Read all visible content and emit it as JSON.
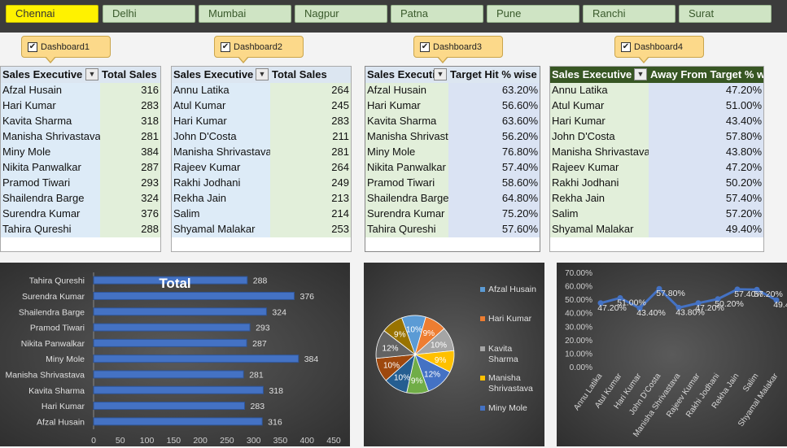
{
  "slicer": {
    "items": [
      "Chennai",
      "Delhi",
      "Mumbai",
      "Nagpur",
      "Patna",
      "Pune",
      "Ranchi",
      "Surat"
    ],
    "selected": "Chennai",
    "colors": {
      "selected": "#fff200",
      "normal": "#cfe4c4"
    }
  },
  "dashboards": [
    "Dashboard1",
    "Dashboard2",
    "Dashboard3",
    "Dashboard4"
  ],
  "tables": [
    {
      "col1": "Sales Executive",
      "col2": "Total Sales",
      "rows": [
        [
          "Afzal Husain",
          "316"
        ],
        [
          "Hari Kumar",
          "283"
        ],
        [
          "Kavita Sharma",
          "318"
        ],
        [
          "Manisha Shrivastava",
          "281"
        ],
        [
          "Miny Mole",
          "384"
        ],
        [
          "Nikita Panwalkar",
          "287"
        ],
        [
          "Pramod Tiwari",
          "293"
        ],
        [
          "Shailendra Barge",
          "324"
        ],
        [
          "Surendra Kumar",
          "376"
        ],
        [
          "Tahira Qureshi",
          "288"
        ]
      ]
    },
    {
      "col1": "Sales Executive",
      "col2": "Total Sales",
      "rows": [
        [
          "Annu Latika",
          "264"
        ],
        [
          "Atul Kumar",
          "245"
        ],
        [
          "Hari Kumar",
          "283"
        ],
        [
          "John D'Costa",
          "211"
        ],
        [
          "Manisha Shrivastava",
          "281"
        ],
        [
          "Rajeev Kumar",
          "264"
        ],
        [
          "Rakhi Jodhani",
          "249"
        ],
        [
          "Rekha Jain",
          "213"
        ],
        [
          "Salim",
          "214"
        ],
        [
          "Shyamal Malakar",
          "253"
        ]
      ]
    },
    {
      "col1": "Sales Executive",
      "col2": "Target Hit % wise",
      "rows": [
        [
          "Afzal Husain",
          "63.20%"
        ],
        [
          "Hari Kumar",
          "56.60%"
        ],
        [
          "Kavita Sharma",
          "63.60%"
        ],
        [
          "Manisha Shrivastava",
          "56.20%"
        ],
        [
          "Miny Mole",
          "76.80%"
        ],
        [
          "Nikita Panwalkar",
          "57.40%"
        ],
        [
          "Pramod Tiwari",
          "58.60%"
        ],
        [
          "Shailendra Barge",
          "64.80%"
        ],
        [
          "Surendra Kumar",
          "75.20%"
        ],
        [
          "Tahira Qureshi",
          "57.60%"
        ]
      ]
    },
    {
      "col1": "Sales Executive",
      "col2": "Away From Target % wise",
      "rows": [
        [
          "Annu Latika",
          "47.20%"
        ],
        [
          "Atul Kumar",
          "51.00%"
        ],
        [
          "Hari Kumar",
          "43.40%"
        ],
        [
          "John D'Costa",
          "57.80%"
        ],
        [
          "Manisha Shrivastava",
          "43.80%"
        ],
        [
          "Rajeev Kumar",
          "47.20%"
        ],
        [
          "Rakhi Jodhani",
          "50.20%"
        ],
        [
          "Rekha Jain",
          "57.40%"
        ],
        [
          "Salim",
          "57.20%"
        ],
        [
          "Shyamal Malakar",
          "49.40%"
        ]
      ]
    }
  ],
  "chart_data": [
    {
      "type": "bar",
      "orientation": "horizontal",
      "title": "Total",
      "categories": [
        "Afzal Husain",
        "Hari Kumar",
        "Kavita Sharma",
        "Manisha Shrivastava",
        "Miny Mole",
        "Nikita Panwalkar",
        "Pramod Tiwari",
        "Shailendra Barge",
        "Surendra Kumar",
        "Tahira Qureshi"
      ],
      "values": [
        316,
        283,
        318,
        281,
        384,
        287,
        293,
        324,
        376,
        288
      ],
      "xlim": [
        0,
        450
      ],
      "xticks": [
        0,
        50,
        100,
        150,
        200,
        250,
        300,
        350,
        400,
        450
      ],
      "bar_color": "#4472c4"
    },
    {
      "type": "pie",
      "legend_placement": "right",
      "slice_labels": [
        "10%",
        "9%",
        "10%",
        "9%",
        "12%",
        "9%",
        "10%",
        "10%",
        "12%",
        "9%"
      ],
      "values": [
        10,
        9,
        10,
        9,
        12,
        9,
        10,
        10,
        12,
        9
      ],
      "legend": [
        "Afzal Husain",
        "Hari Kumar",
        "Kavita Sharma",
        "Manisha Shrivastava",
        "Miny Mole"
      ],
      "colors": [
        "#5b9bd5",
        "#ed7d31",
        "#a5a5a5",
        "#ffc000",
        "#4472c4",
        "#70ad47",
        "#255e91",
        "#9e480e",
        "#636363",
        "#997300"
      ]
    },
    {
      "type": "line",
      "categories": [
        "Annu Latika",
        "Atul Kumar",
        "Hari Kumar",
        "John D'Costa",
        "Manisha Shrivastava",
        "Rajeev Kumar",
        "Rakhi Jodhani",
        "Rekha Jain",
        "Salim",
        "Shyamal Malakar"
      ],
      "values": [
        47.2,
        51.0,
        43.4,
        57.8,
        43.8,
        47.2,
        50.2,
        57.4,
        57.2,
        49.4
      ],
      "labels": [
        "47.20%",
        "51.00%",
        "43.40%",
        "57.80%",
        "43.80%",
        "47.20%",
        "50.20%",
        "57.40%",
        "57.20%",
        "49.40%"
      ],
      "ylim": [
        0,
        70
      ],
      "yticks": [
        "0.00%",
        "10.00%",
        "20.00%",
        "30.00%",
        "40.00%",
        "50.00%",
        "60.00%",
        "70.00%"
      ],
      "line_color": "#4472c4"
    }
  ]
}
